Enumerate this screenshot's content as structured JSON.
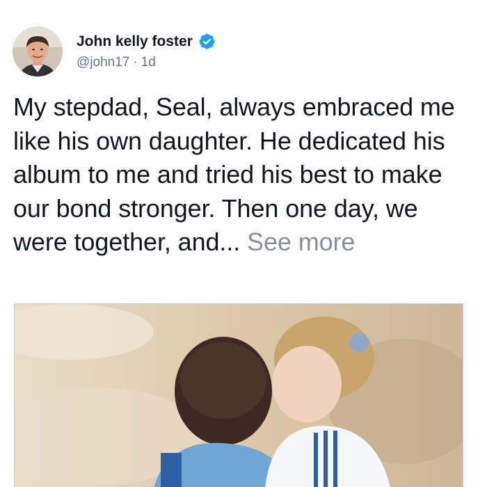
{
  "tweet": {
    "author": {
      "display_name": "John kelly foster",
      "handle": "@john17",
      "separator": "·",
      "time": "1d",
      "verified": true,
      "verified_badge_color": "#1da1f2"
    },
    "text": "My stepdad, Seal, always embraced me like his own daughter. He dedicated his album to me and tried his best to make our bond stronger. Then one day, we were together, and...",
    "see_more_label": "See more",
    "colors": {
      "text": "#14171a",
      "secondary_text": "#657786",
      "see_more": "#8a8f94"
    },
    "icons": {
      "verified": "verified-badge-icon",
      "avatar": "avatar-photo"
    }
  }
}
